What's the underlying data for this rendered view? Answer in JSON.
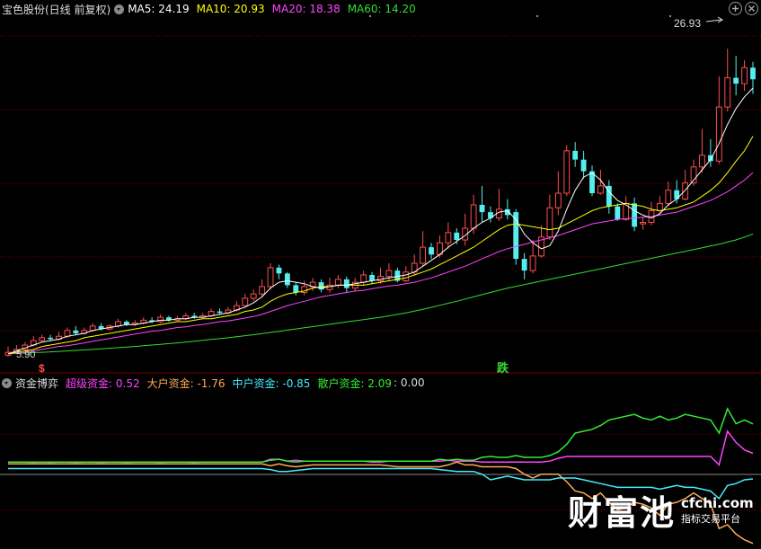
{
  "main_panel": {
    "stock_name": "宝色股份(日线 前复权)",
    "ma": [
      {
        "label": "MA5: 24.19",
        "color": "#ffffff"
      },
      {
        "label": "MA10: 20.93",
        "color": "#ffff00"
      },
      {
        "label": "MA20: 18.38",
        "color": "#ff44ff"
      },
      {
        "label": "MA60: 14.20",
        "color": "#33dd33"
      }
    ],
    "high_label": "26.93",
    "low_label": "5.90",
    "buy_signal": "$",
    "sell_signal": "跌"
  },
  "sub_panel": {
    "indicator_name": "资金博弈",
    "items": [
      {
        "label": "超级资金: 0.52",
        "color": "#ff44ff"
      },
      {
        "label": "大户资金: -1.76",
        "color": "#ffaa55"
      },
      {
        "label": "中户资金: -0.85",
        "color": "#44eeff"
      },
      {
        "label": "散户资金: 2.09",
        "color": "#33ee33"
      },
      {
        "label": ": 0.00",
        "color": "#dddddd"
      }
    ]
  },
  "controls": {
    "add_icon": "plus-circle-icon",
    "close_icon": "close-circle-icon"
  },
  "watermark": {
    "big": "财富池",
    "url": "cfchi.com",
    "sub": "指标交易平台"
  },
  "colors": {
    "up": "#ff4d4d",
    "down": "#55eeee",
    "ma5": "#ffffff",
    "ma10": "#ffff00",
    "ma20": "#ff44ff",
    "ma60": "#33dd33",
    "grid": "#7a0000"
  },
  "chart_data": {
    "type": "candlestick",
    "ylim": [
      5.0,
      29.0
    ],
    "candles": [
      [
        5.9,
        6.1,
        6.5,
        5.8
      ],
      [
        6.1,
        6.3,
        6.6,
        6.0
      ],
      [
        6.3,
        6.6,
        6.8,
        6.2
      ],
      [
        6.6,
        6.9,
        7.2,
        6.5
      ],
      [
        6.9,
        7.1,
        7.3,
        6.8
      ],
      [
        7.1,
        7.0,
        7.3,
        6.9
      ],
      [
        7.0,
        7.2,
        7.5,
        6.9
      ],
      [
        7.2,
        7.6,
        7.8,
        7.1
      ],
      [
        7.6,
        7.4,
        7.9,
        7.3
      ],
      [
        7.4,
        7.6,
        7.8,
        7.3
      ],
      [
        7.6,
        7.9,
        8.1,
        7.5
      ],
      [
        7.9,
        7.7,
        8.1,
        7.6
      ],
      [
        7.7,
        7.9,
        8.0,
        7.6
      ],
      [
        7.9,
        8.2,
        8.4,
        7.8
      ],
      [
        8.2,
        8.0,
        8.3,
        7.9
      ],
      [
        8.0,
        8.1,
        8.3,
        7.9
      ],
      [
        8.1,
        8.3,
        8.5,
        8.0
      ],
      [
        8.3,
        8.2,
        8.5,
        8.1
      ],
      [
        8.2,
        8.5,
        8.7,
        8.1
      ],
      [
        8.5,
        8.3,
        8.6,
        8.2
      ],
      [
        8.3,
        8.4,
        8.6,
        8.2
      ],
      [
        8.4,
        8.6,
        8.8,
        8.3
      ],
      [
        8.6,
        8.5,
        8.8,
        8.4
      ],
      [
        8.5,
        8.6,
        8.8,
        8.4
      ],
      [
        8.6,
        8.9,
        9.1,
        8.5
      ],
      [
        8.9,
        8.8,
        9.1,
        8.7
      ],
      [
        8.8,
        9.0,
        9.2,
        8.7
      ],
      [
        9.0,
        9.3,
        9.6,
        8.9
      ],
      [
        9.3,
        9.8,
        10.1,
        9.2
      ],
      [
        9.8,
        10.1,
        10.4,
        9.6
      ],
      [
        10.1,
        10.6,
        11.1,
        9.9
      ],
      [
        10.6,
        11.9,
        12.2,
        10.4
      ],
      [
        11.9,
        11.5,
        12.1,
        11.1
      ],
      [
        11.5,
        10.7,
        11.6,
        10.5
      ],
      [
        10.7,
        10.2,
        10.9,
        10.0
      ],
      [
        10.2,
        10.6,
        11.0,
        10.0
      ],
      [
        10.6,
        10.9,
        11.2,
        10.3
      ],
      [
        10.9,
        10.4,
        11.1,
        10.2
      ],
      [
        10.4,
        10.7,
        11.2,
        10.2
      ],
      [
        10.7,
        11.1,
        11.4,
        10.5
      ],
      [
        11.1,
        10.5,
        11.3,
        10.2
      ],
      [
        10.5,
        10.9,
        11.2,
        10.3
      ],
      [
        10.9,
        11.4,
        11.7,
        10.7
      ],
      [
        11.4,
        11.0,
        11.6,
        10.8
      ],
      [
        11.0,
        11.3,
        11.9,
        10.8
      ],
      [
        11.3,
        11.7,
        12.2,
        11.0
      ],
      [
        11.7,
        11.0,
        11.9,
        10.9
      ],
      [
        11.0,
        11.6,
        12.0,
        10.9
      ],
      [
        11.6,
        12.2,
        12.8,
        11.4
      ],
      [
        12.2,
        13.3,
        14.4,
        12.0
      ],
      [
        13.3,
        12.8,
        13.6,
        12.5
      ],
      [
        12.8,
        13.6,
        14.1,
        12.6
      ],
      [
        13.6,
        14.3,
        15.0,
        13.2
      ],
      [
        14.3,
        13.8,
        14.6,
        13.5
      ],
      [
        13.8,
        14.6,
        15.6,
        13.4
      ],
      [
        14.6,
        16.2,
        16.9,
        14.2
      ],
      [
        16.2,
        15.7,
        17.5,
        15.0
      ],
      [
        15.7,
        15.3,
        16.1,
        15.0
      ],
      [
        15.3,
        15.9,
        17.3,
        15.1
      ],
      [
        15.9,
        15.5,
        16.6,
        15.2
      ],
      [
        15.7,
        12.5,
        15.9,
        12.1
      ],
      [
        12.5,
        11.7,
        12.9,
        11.1
      ],
      [
        11.7,
        12.7,
        13.8,
        11.5
      ],
      [
        12.7,
        14.0,
        14.8,
        12.6
      ],
      [
        14.0,
        16.0,
        16.9,
        13.8
      ],
      [
        16.0,
        17.0,
        18.5,
        15.5
      ],
      [
        17.0,
        19.9,
        20.3,
        16.8
      ],
      [
        19.9,
        19.3,
        20.5,
        18.8
      ],
      [
        19.3,
        18.5,
        19.9,
        18.0
      ],
      [
        18.5,
        17.0,
        18.9,
        16.8
      ],
      [
        17.0,
        17.5,
        18.6,
        16.9
      ],
      [
        17.5,
        16.1,
        17.9,
        15.6
      ],
      [
        16.1,
        15.2,
        16.3,
        15.1
      ],
      [
        15.2,
        16.3,
        16.8,
        15.1
      ],
      [
        16.3,
        14.7,
        16.7,
        14.4
      ],
      [
        14.9,
        15.0,
        15.4,
        14.5
      ],
      [
        15.0,
        15.8,
        16.4,
        14.8
      ],
      [
        15.8,
        16.3,
        16.8,
        15.6
      ],
      [
        16.3,
        17.2,
        17.8,
        16.1
      ],
      [
        17.2,
        16.6,
        17.9,
        16.3
      ],
      [
        16.6,
        17.7,
        18.6,
        16.5
      ],
      [
        17.7,
        18.8,
        19.3,
        17.5
      ],
      [
        18.8,
        19.6,
        21.4,
        18.4
      ],
      [
        19.6,
        19.2,
        20.7,
        18.8
      ],
      [
        19.2,
        22.9,
        25.0,
        19.0
      ],
      [
        22.9,
        24.9,
        26.9,
        22.6
      ],
      [
        24.9,
        24.5,
        26.4,
        23.7
      ],
      [
        24.5,
        25.6,
        26.1,
        24.0
      ],
      [
        25.6,
        24.8,
        26.0,
        23.8
      ]
    ],
    "ma5": [
      6.0,
      6.2,
      6.4,
      6.6,
      6.8,
      6.9,
      7.0,
      7.2,
      7.3,
      7.4,
      7.6,
      7.7,
      7.8,
      7.9,
      8.0,
      8.0,
      8.1,
      8.2,
      8.3,
      8.3,
      8.4,
      8.4,
      8.5,
      8.5,
      8.6,
      8.7,
      8.8,
      9.0,
      9.2,
      9.5,
      9.9,
      10.5,
      10.9,
      11.0,
      10.9,
      10.8,
      10.6,
      10.5,
      10.6,
      10.7,
      10.7,
      10.8,
      10.9,
      11.0,
      11.1,
      11.2,
      11.3,
      11.4,
      11.6,
      12.0,
      12.4,
      12.8,
      13.3,
      13.7,
      14.1,
      14.6,
      15.0,
      15.3,
      15.7,
      15.8,
      15.2,
      14.2,
      13.6,
      13.2,
      13.4,
      14.4,
      15.9,
      17.2,
      18.1,
      18.4,
      17.9,
      17.1,
      16.5,
      16.2,
      15.8,
      15.5,
      15.3,
      15.6,
      16.2,
      16.6,
      17.2,
      17.9,
      18.6,
      19.3,
      20.4,
      21.7,
      22.8,
      23.6,
      24.2
    ],
    "ma10": [
      6.0,
      6.1,
      6.2,
      6.3,
      6.5,
      6.6,
      6.7,
      6.8,
      6.9,
      7.1,
      7.2,
      7.3,
      7.4,
      7.5,
      7.6,
      7.7,
      7.8,
      7.9,
      8.0,
      8.1,
      8.2,
      8.2,
      8.3,
      8.4,
      8.4,
      8.5,
      8.6,
      8.7,
      8.9,
      9.0,
      9.2,
      9.6,
      9.9,
      10.1,
      10.2,
      10.3,
      10.5,
      10.6,
      10.6,
      10.7,
      10.7,
      10.7,
      10.7,
      10.8,
      10.9,
      11.0,
      11.1,
      11.2,
      11.4,
      11.6,
      11.8,
      12.1,
      12.4,
      12.7,
      13.0,
      13.3,
      13.7,
      14.1,
      14.5,
      14.8,
      14.9,
      14.8,
      14.7,
      14.6,
      14.5,
      14.6,
      14.9,
      15.2,
      15.5,
      15.8,
      16.0,
      16.1,
      16.2,
      16.3,
      16.2,
      16.1,
      15.9,
      15.8,
      15.9,
      16.0,
      16.2,
      16.4,
      16.8,
      17.2,
      17.7,
      18.4,
      19.2,
      19.9,
      20.9
    ],
    "ma20": [
      6.0,
      6.05,
      6.1,
      6.2,
      6.3,
      6.4,
      6.5,
      6.55,
      6.65,
      6.75,
      6.85,
      6.95,
      7.05,
      7.15,
      7.25,
      7.35,
      7.45,
      7.55,
      7.6,
      7.7,
      7.8,
      7.85,
      7.95,
      8.0,
      8.1,
      8.2,
      8.25,
      8.35,
      8.45,
      8.55,
      8.7,
      8.9,
      9.1,
      9.3,
      9.45,
      9.6,
      9.75,
      9.9,
      10.0,
      10.1,
      10.2,
      10.3,
      10.35,
      10.45,
      10.55,
      10.65,
      10.7,
      10.8,
      10.9,
      11.05,
      11.2,
      11.4,
      11.6,
      11.8,
      12.0,
      12.25,
      12.5,
      12.75,
      13.0,
      13.2,
      13.35,
      13.5,
      13.65,
      13.8,
      13.95,
      14.1,
      14.3,
      14.5,
      14.7,
      14.9,
      15.0,
      15.1,
      15.2,
      15.25,
      15.3,
      15.35,
      15.4,
      15.5,
      15.6,
      15.7,
      15.9,
      16.1,
      16.3,
      16.5,
      16.8,
      17.1,
      17.5,
      17.9,
      18.4
    ],
    "ma60": [
      6.0,
      6.02,
      6.05,
      6.08,
      6.1,
      6.13,
      6.16,
      6.2,
      6.23,
      6.27,
      6.3,
      6.34,
      6.38,
      6.42,
      6.46,
      6.5,
      6.55,
      6.6,
      6.65,
      6.7,
      6.75,
      6.8,
      6.86,
      6.92,
      6.98,
      7.04,
      7.1,
      7.17,
      7.24,
      7.31,
      7.38,
      7.46,
      7.54,
      7.62,
      7.7,
      7.78,
      7.86,
      7.94,
      8.02,
      8.1,
      8.18,
      8.26,
      8.34,
      8.42,
      8.5,
      8.6,
      8.7,
      8.8,
      8.92,
      9.05,
      9.18,
      9.32,
      9.46,
      9.6,
      9.75,
      9.9,
      10.05,
      10.2,
      10.35,
      10.5,
      10.62,
      10.74,
      10.86,
      10.98,
      11.1,
      11.22,
      11.34,
      11.46,
      11.58,
      11.7,
      11.82,
      11.94,
      12.06,
      12.18,
      12.3,
      12.42,
      12.54,
      12.66,
      12.78,
      12.9,
      13.02,
      13.14,
      13.26,
      13.38,
      13.5,
      13.65,
      13.8,
      14.0,
      14.2
    ],
    "sub": {
      "ylim": [
        -4.5,
        4.0
      ],
      "super": [
        0.05,
        0.05,
        0.05,
        0.04,
        0.05,
        0.04,
        0.05,
        0.05,
        0.04,
        0.05,
        0.05,
        0.04,
        0.05,
        0.05,
        0.04,
        0.05,
        0.05,
        0.05,
        0.04,
        0.05,
        0.05,
        0.05,
        0.04,
        0.05,
        0.05,
        0.05,
        0.05,
        0.05,
        0.05,
        0.05,
        0.05,
        0.2,
        0.2,
        0.1,
        0.15,
        0.1,
        0.1,
        0.1,
        0.1,
        0.1,
        0.1,
        0.1,
        0.1,
        0.05,
        0.05,
        0.1,
        0.1,
        0.1,
        0.1,
        0.1,
        0.1,
        0.1,
        0.15,
        0.1,
        0.1,
        0.1,
        0.05,
        0.05,
        0.05,
        0.05,
        0.05,
        0.05,
        0.05,
        0.05,
        0.1,
        0.25,
        0.35,
        0.35,
        0.35,
        0.35,
        0.35,
        0.35,
        0.35,
        0.35,
        0.35,
        0.35,
        0.35,
        0.35,
        0.35,
        0.35,
        0.35,
        0.35,
        0.35,
        0.35,
        -0.1,
        1.7,
        1.1,
        0.7,
        0.52
      ],
      "big": [
        -0.05,
        -0.05,
        -0.05,
        -0.05,
        -0.05,
        -0.05,
        -0.05,
        -0.05,
        -0.05,
        -0.05,
        -0.05,
        -0.05,
        -0.05,
        -0.05,
        -0.05,
        -0.05,
        -0.05,
        -0.05,
        -0.05,
        -0.05,
        -0.05,
        -0.05,
        -0.05,
        -0.05,
        -0.05,
        -0.05,
        -0.05,
        -0.05,
        -0.05,
        -0.05,
        -0.05,
        -0.15,
        -0.05,
        -0.15,
        -0.2,
        -0.15,
        -0.1,
        -0.1,
        -0.1,
        -0.1,
        -0.1,
        -0.1,
        -0.1,
        -0.1,
        -0.1,
        -0.15,
        -0.2,
        -0.2,
        -0.2,
        -0.2,
        -0.2,
        -0.2,
        -0.1,
        0.05,
        -0.1,
        -0.1,
        -0.2,
        -0.2,
        -0.2,
        -0.2,
        -0.3,
        -0.6,
        -0.8,
        -0.6,
        -0.6,
        -0.6,
        -1.0,
        -1.5,
        -1.6,
        -1.9,
        -1.6,
        -2.1,
        -2.5,
        -2.4,
        -2.1,
        -2.2,
        -2.4,
        -2.8,
        -2.2,
        -2.1,
        -1.9,
        -1.6,
        -1.9,
        -2.2,
        -3.5,
        -3.3,
        -3.8,
        -4.1,
        -4.3
      ],
      "mid": [
        -0.3,
        -0.3,
        -0.3,
        -0.3,
        -0.3,
        -0.3,
        -0.3,
        -0.3,
        -0.3,
        -0.3,
        -0.3,
        -0.3,
        -0.3,
        -0.3,
        -0.3,
        -0.3,
        -0.3,
        -0.3,
        -0.3,
        -0.3,
        -0.3,
        -0.3,
        -0.3,
        -0.3,
        -0.3,
        -0.3,
        -0.3,
        -0.3,
        -0.3,
        -0.3,
        -0.3,
        -0.35,
        -0.45,
        -0.45,
        -0.4,
        -0.35,
        -0.3,
        -0.3,
        -0.3,
        -0.3,
        -0.3,
        -0.3,
        -0.3,
        -0.3,
        -0.3,
        -0.3,
        -0.3,
        -0.3,
        -0.3,
        -0.3,
        -0.3,
        -0.35,
        -0.4,
        -0.45,
        -0.45,
        -0.45,
        -0.6,
        -0.9,
        -0.8,
        -0.7,
        -0.8,
        -0.9,
        -0.9,
        -0.9,
        -0.9,
        -0.8,
        -0.8,
        -0.8,
        -0.9,
        -1.0,
        -1.1,
        -1.2,
        -1.3,
        -1.3,
        -1.3,
        -1.3,
        -1.3,
        -1.4,
        -1.3,
        -1.2,
        -1.3,
        -1.3,
        -1.4,
        -1.5,
        -1.9,
        -1.2,
        -1.1,
        -0.9,
        -0.85
      ],
      "small": [
        0.05,
        0.05,
        0.05,
        0.05,
        0.05,
        0.05,
        0.05,
        0.05,
        0.05,
        0.05,
        0.05,
        0.05,
        0.05,
        0.05,
        0.05,
        0.05,
        0.05,
        0.05,
        0.05,
        0.05,
        0.05,
        0.05,
        0.05,
        0.05,
        0.05,
        0.05,
        0.05,
        0.05,
        0.05,
        0.05,
        0.05,
        0.15,
        0.2,
        0.1,
        0.05,
        0.1,
        0.1,
        0.1,
        0.1,
        0.1,
        0.1,
        0.1,
        0.1,
        0.1,
        0.1,
        0.1,
        0.1,
        0.1,
        0.1,
        0.1,
        0.1,
        0.2,
        0.15,
        0.2,
        0.15,
        0.15,
        0.3,
        0.35,
        0.3,
        0.3,
        0.4,
        0.3,
        0.3,
        0.3,
        0.4,
        0.6,
        1.0,
        1.6,
        1.7,
        1.8,
        2.0,
        2.3,
        2.4,
        2.5,
        2.6,
        2.4,
        2.3,
        2.5,
        2.3,
        2.4,
        2.6,
        2.5,
        2.4,
        2.3,
        1.6,
        2.9,
        2.1,
        2.3,
        2.09
      ]
    }
  }
}
